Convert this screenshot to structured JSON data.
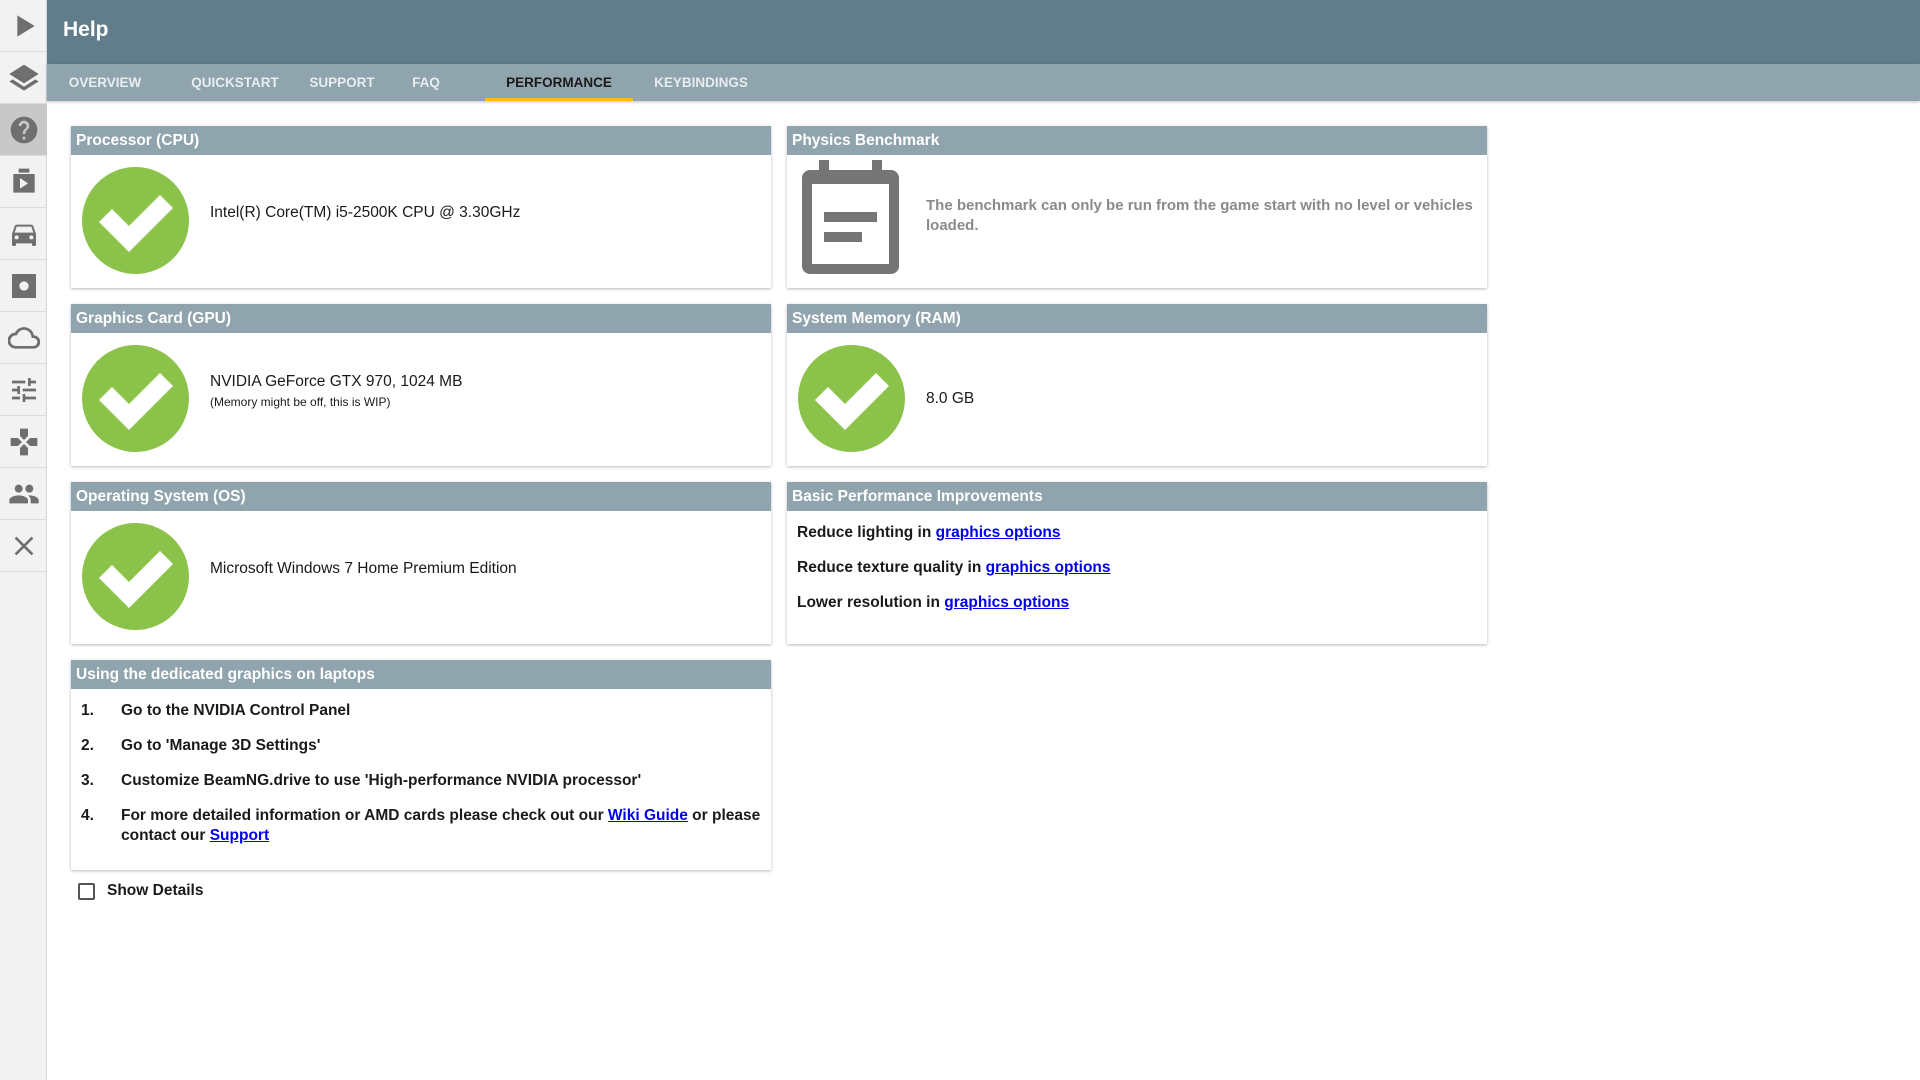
{
  "sidebar": {
    "items": [
      {
        "icon": "play-icon"
      },
      {
        "icon": "layers-icon"
      },
      {
        "icon": "help-icon",
        "active": true
      },
      {
        "icon": "video-icon"
      },
      {
        "icon": "car-icon"
      },
      {
        "icon": "settings-icon"
      },
      {
        "icon": "cloud-icon"
      },
      {
        "icon": "sliders-icon"
      },
      {
        "icon": "gamepad-icon"
      },
      {
        "icon": "people-icon"
      },
      {
        "icon": "close-icon"
      }
    ]
  },
  "header": {
    "title": "Help"
  },
  "tabs": [
    {
      "label": "OVERVIEW"
    },
    {
      "label": "QUICKSTART"
    },
    {
      "label": "SUPPORT"
    },
    {
      "label": "FAQ"
    },
    {
      "label": "PERFORMANCE",
      "active": true
    },
    {
      "label": "KEYBINDINGS"
    }
  ],
  "cards": {
    "cpu": {
      "title": "Processor (CPU)",
      "value": "Intel(R) Core(TM) i5-2500K CPU @ 3.30GHz"
    },
    "gpu": {
      "title": "Graphics Card (GPU)",
      "value": "NVIDIA GeForce GTX 970, 1024 MB",
      "note": "(Memory might be off, this is WIP)"
    },
    "os": {
      "title": "Operating System (OS)",
      "value": "Microsoft Windows 7 Home Premium Edition"
    },
    "benchmark": {
      "title": "Physics Benchmark",
      "text": "The benchmark can only be run from the game start with no level or vehicles loaded."
    },
    "ram": {
      "title": "System Memory (RAM)",
      "value": "8.0 GB"
    },
    "improvements": {
      "title": "Basic Performance Improvements",
      "items": [
        {
          "text": "Reduce lighting in ",
          "link": "graphics options"
        },
        {
          "text": "Reduce texture quality in ",
          "link": "graphics options"
        },
        {
          "text": "Lower resolution in ",
          "link": "graphics options"
        }
      ]
    },
    "laptops": {
      "title": "Using the dedicated graphics on laptops",
      "steps": [
        {
          "num": "1.",
          "text": "Go to the NVIDIA Control Panel"
        },
        {
          "num": "2.",
          "text": "Go to 'Manage 3D Settings'"
        },
        {
          "num": "3.",
          "text": "Customize BeamNG.drive to use 'High-performance NVIDIA processor'"
        },
        {
          "num": "4.",
          "text_a": "For more detailed information or AMD cards please check out our ",
          "link_a": "Wiki Guide",
          "text_b": " or please contact our ",
          "link_b": "Support"
        }
      ]
    }
  },
  "details": {
    "label": "Show Details",
    "checked": false
  },
  "colors": {
    "header": "#617d8b",
    "tabbar": "#90a4ae",
    "card_header": "#90a4ae",
    "check": "#8bc34a",
    "tab_indicator": "#ffc107"
  }
}
